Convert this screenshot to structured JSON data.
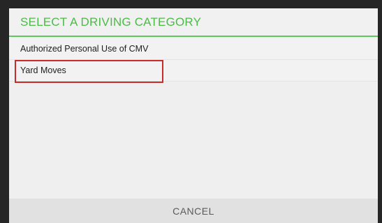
{
  "dialog": {
    "title": "SELECT A DRIVING CATEGORY",
    "accent_color": "#4cbb47",
    "highlight_color": "#c92a2a",
    "items": [
      {
        "label": "Authorized Personal Use of CMV"
      },
      {
        "label": "Yard Moves"
      }
    ],
    "cancel_label": "CANCEL"
  }
}
